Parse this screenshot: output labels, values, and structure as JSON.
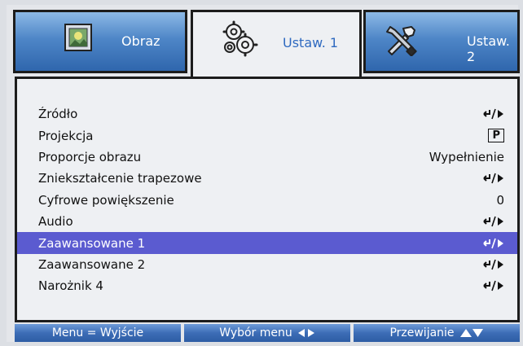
{
  "tabs": [
    {
      "label": "Obraz",
      "icon": "picture-icon"
    },
    {
      "label": "Ustaw. 1",
      "icon": "gears-icon"
    },
    {
      "label": "Ustaw. 2",
      "icon": "tools-icon"
    }
  ],
  "active_tab": "Ustaw. 1",
  "menu": {
    "items": [
      {
        "label": "Źródło",
        "value": "enter-arrow-icon"
      },
      {
        "label": "Projekcja",
        "value": "P"
      },
      {
        "label": "Proporcje obrazu",
        "value": "Wypełnienie"
      },
      {
        "label": "Zniekształcenie trapezowe",
        "value": "enter-arrow-icon"
      },
      {
        "label": "Cyfrowe powiększenie",
        "value": "0"
      },
      {
        "label": "Audio",
        "value": "enter-arrow-icon"
      },
      {
        "label": "Zaawansowane 1",
        "value": "enter-arrow-icon"
      },
      {
        "label": "Zaawansowane 2",
        "value": "enter-arrow-icon"
      },
      {
        "label": "Narożnik 4",
        "value": "enter-arrow-icon"
      }
    ],
    "selected_item": "Zaawansowane 1"
  },
  "footer": {
    "menu_exit": "Menu = Wyjście",
    "select_menu": "Wybór menu",
    "scroll": "Przewijanie"
  },
  "colors": {
    "tab_blue": "#4e86c7",
    "selection": "#5b5bd0",
    "active_tab_text": "#2f6ac0"
  }
}
